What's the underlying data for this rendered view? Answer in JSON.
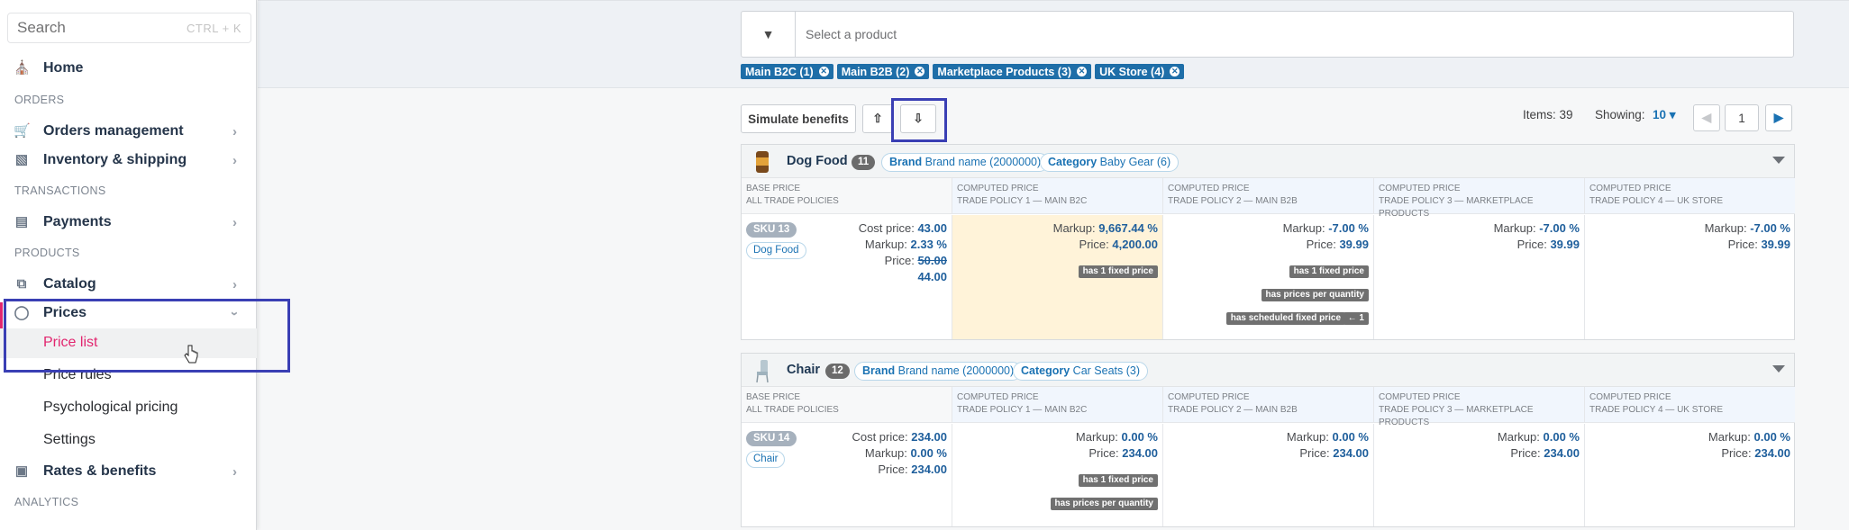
{
  "sidebar": {
    "search_placeholder": "Search",
    "search_shortcut": "CTRL + K",
    "home": "Home",
    "sec_orders": "ORDERS",
    "orders": "Orders management",
    "inventory": "Inventory & shipping",
    "sec_transactions": "TRANSACTIONS",
    "payments": "Payments",
    "sec_products": "PRODUCTS",
    "catalog": "Catalog",
    "prices": "Prices",
    "price_list": "Price list",
    "price_rules": "Price rules",
    "psych": "Psychological pricing",
    "settings": "Settings",
    "rates": "Rates & benefits",
    "sec_analytics": "ANALYTICS"
  },
  "filter": {
    "placeholder": "Select a product",
    "chips": [
      "Main B2C (1)",
      "Main B2B (2)",
      "Marketplace Products (3)",
      "UK Store (4)"
    ]
  },
  "toolbar": {
    "simulate": "Simulate benefits",
    "items_label": "Items: 39",
    "showing_label": "Showing:",
    "showing_value": "10",
    "page": "1"
  },
  "columns": [
    {
      "top": "BASE PRICE",
      "bottom": "ALL TRADE POLICIES"
    },
    {
      "top": "COMPUTED PRICE",
      "bottom": "TRADE POLICY 1 — MAIN B2C"
    },
    {
      "top": "COMPUTED PRICE",
      "bottom": "TRADE POLICY 2 — MAIN B2B"
    },
    {
      "top": "COMPUTED PRICE",
      "bottom": "TRADE POLICY 3 — MARKETPLACE PRODUCTS"
    },
    {
      "top": "COMPUTED PRICE",
      "bottom": "TRADE POLICY 4 — UK STORE"
    }
  ],
  "products": [
    {
      "name": "Dog Food",
      "count": "11",
      "brand_label": "Brand",
      "brand_value": "Brand name (2000000)",
      "cat_label": "Category",
      "cat_value": "Baby Gear (6)",
      "sku": "SKU 13",
      "sku_tag": "Dog Food",
      "base": {
        "cost_l": "Cost price:",
        "cost_v": "43.00",
        "markup_l": "Markup:",
        "markup_v": "2.33 %",
        "price_l": "Price:",
        "price_old": "50.00",
        "price_v": "44.00"
      },
      "tp": [
        {
          "markup": "9,667.44 %",
          "price": "4,200.00"
        },
        {
          "markup": "-7.00 %",
          "price": "39.99"
        },
        {
          "markup": "-7.00 %",
          "price": "39.99"
        },
        {
          "markup": "-7.00 %",
          "price": "39.99"
        }
      ],
      "flags1": [
        "has 1 fixed price"
      ],
      "flags2": [
        "has 1 fixed price",
        "has prices per quantity",
        "has scheduled fixed price",
        "← 1"
      ]
    },
    {
      "name": "Chair",
      "count": "12",
      "brand_label": "Brand",
      "brand_value": "Brand name (2000000)",
      "cat_label": "Category",
      "cat_value": "Car Seats (3)",
      "sku": "SKU 14",
      "sku_tag": "Chair",
      "base": {
        "cost_l": "Cost price:",
        "cost_v": "234.00",
        "markup_l": "Markup:",
        "markup_v": "0.00 %",
        "price_l": "Price:",
        "price_v": "234.00"
      },
      "tp": [
        {
          "markup": "0.00 %",
          "price": "234.00"
        },
        {
          "markup": "0.00 %",
          "price": "234.00"
        },
        {
          "markup": "0.00 %",
          "price": "234.00"
        },
        {
          "markup": "0.00 %",
          "price": "234.00"
        }
      ],
      "flags1": [
        "has 1 fixed price",
        "has prices per quantity"
      ]
    }
  ],
  "labels": {
    "markup": "Markup:",
    "price": "Price:"
  }
}
